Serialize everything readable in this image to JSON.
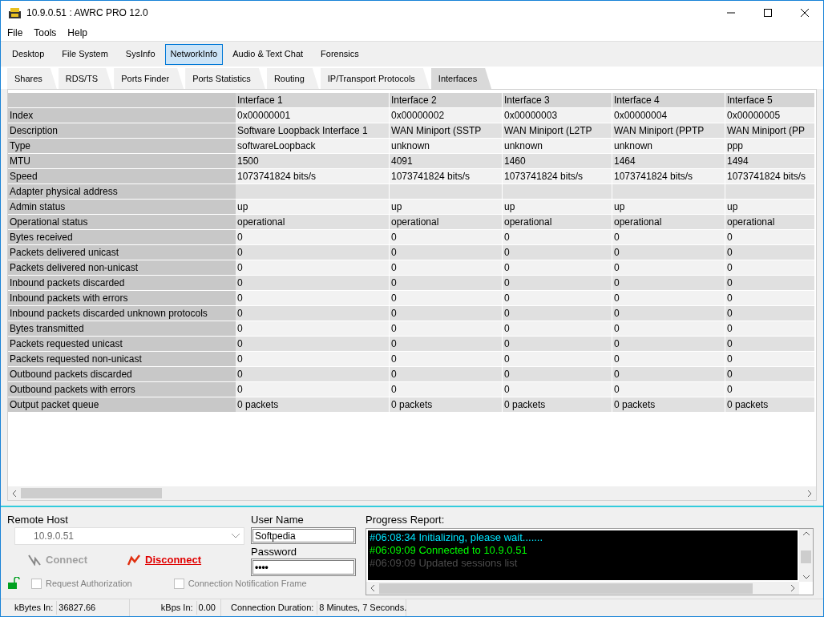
{
  "window": {
    "title": "10.9.0.51 : AWRC PRO 12.0"
  },
  "menu": [
    "File",
    "Tools",
    "Help"
  ],
  "tabs": [
    {
      "label": "Desktop",
      "selected": false
    },
    {
      "label": "File System",
      "selected": false
    },
    {
      "label": "SysInfo",
      "selected": false
    },
    {
      "label": "NetworkInfo",
      "selected": true
    },
    {
      "label": "Audio & Text Chat",
      "selected": false
    },
    {
      "label": "Forensics",
      "selected": false
    }
  ],
  "subtabs": [
    {
      "label": "Shares",
      "selected": false
    },
    {
      "label": "RDS/TS",
      "selected": false
    },
    {
      "label": "Ports Finder",
      "selected": false
    },
    {
      "label": "Ports Statistics",
      "selected": false
    },
    {
      "label": "Routing",
      "selected": false
    },
    {
      "label": "IP/Transport Protocols",
      "selected": false
    },
    {
      "label": "Interfaces",
      "selected": true
    }
  ],
  "table": {
    "columns": [
      "Interface 1",
      "Interface 2",
      "Interface 3",
      "Interface 4",
      "Interface 5"
    ],
    "rows": [
      {
        "label": "Index",
        "values": [
          "0x00000001",
          "0x00000002",
          "0x00000003",
          "0x00000004",
          "0x00000005"
        ]
      },
      {
        "label": "Description",
        "values": [
          "Software Loopback Interface 1",
          "WAN Miniport (SSTP",
          "WAN Miniport (L2TP",
          "WAN Miniport (PPTP",
          "WAN Miniport (PP"
        ]
      },
      {
        "label": "Type",
        "values": [
          "softwareLoopback",
          "unknown",
          "unknown",
          "unknown",
          "ppp"
        ]
      },
      {
        "label": "MTU",
        "values": [
          "1500",
          "4091",
          "1460",
          "1464",
          "1494"
        ]
      },
      {
        "label": "Speed",
        "values": [
          "1073741824 bits/s",
          "1073741824 bits/s",
          "1073741824 bits/s",
          "1073741824 bits/s",
          "1073741824 bits/s"
        ]
      },
      {
        "label": "Adapter physical address",
        "values": []
      },
      {
        "label": "Admin status",
        "values": [
          "up",
          "up",
          "up",
          "up",
          "up"
        ]
      },
      {
        "label": "Operational status",
        "values": [
          "operational",
          "operational",
          "operational",
          "operational",
          "operational"
        ]
      },
      {
        "label": "Bytes received",
        "values": [
          "0",
          "0",
          "0",
          "0",
          "0"
        ]
      },
      {
        "label": "Packets delivered unicast",
        "values": [
          "0",
          "0",
          "0",
          "0",
          "0"
        ]
      },
      {
        "label": "Packets delivered non-unicast",
        "values": [
          "0",
          "0",
          "0",
          "0",
          "0"
        ]
      },
      {
        "label": "Inbound packets discarded",
        "values": [
          "0",
          "0",
          "0",
          "0",
          "0"
        ]
      },
      {
        "label": "Inbound packets with errors",
        "values": [
          "0",
          "0",
          "0",
          "0",
          "0"
        ]
      },
      {
        "label": "Inbound packets discarded unknown protocols",
        "values": [
          "0",
          "0",
          "0",
          "0",
          "0"
        ]
      },
      {
        "label": "Bytes transmitted",
        "values": [
          "0",
          "0",
          "0",
          "0",
          "0"
        ]
      },
      {
        "label": "Packets requested unicast",
        "values": [
          "0",
          "0",
          "0",
          "0",
          "0"
        ]
      },
      {
        "label": "Packets requested non-unicast",
        "values": [
          "0",
          "0",
          "0",
          "0",
          "0"
        ]
      },
      {
        "label": "Outbound packets discarded",
        "values": [
          "0",
          "0",
          "0",
          "0",
          "0"
        ]
      },
      {
        "label": "Outbound packets with errors",
        "values": [
          "0",
          "0",
          "0",
          "0",
          "0"
        ]
      },
      {
        "label": "Output packet queue",
        "values": [
          "0 packets",
          "0 packets",
          "0 packets",
          "0 packets",
          "0 packets"
        ]
      }
    ]
  },
  "connection": {
    "remote_host_label": "Remote Host",
    "remote_host": "10.9.0.51",
    "connect": {
      "label": "Connect",
      "disabled": true
    },
    "disconnect": {
      "label": "Disconnect",
      "disabled": false
    },
    "user_name_label": "User Name",
    "user_name": "Softpedia",
    "password_label": "Password",
    "password": "••••",
    "checkboxes": [
      {
        "label": "Request Authorization",
        "checked": false
      },
      {
        "label": "Connection Notification Frame",
        "checked": false
      }
    ]
  },
  "progress": {
    "label": "Progress Report:",
    "lines": [
      {
        "text": "#06:08:34 Initializing, please wait.......",
        "color": "#00e5ff"
      },
      {
        "text": "#06:09:09 Connected to 10.9.0.51",
        "color": "#00ff00"
      },
      {
        "text": "#06:09:09 Updated sessions list",
        "color": "#4d4d4d"
      }
    ]
  },
  "status_bar": [
    {
      "label": "kBytes In:",
      "value": "36827.66"
    },
    {
      "label": "kBps In:",
      "value": "0.00"
    },
    {
      "label": "Connection Duration:",
      "value": "8 Minutes, 7 Seconds."
    }
  ]
}
